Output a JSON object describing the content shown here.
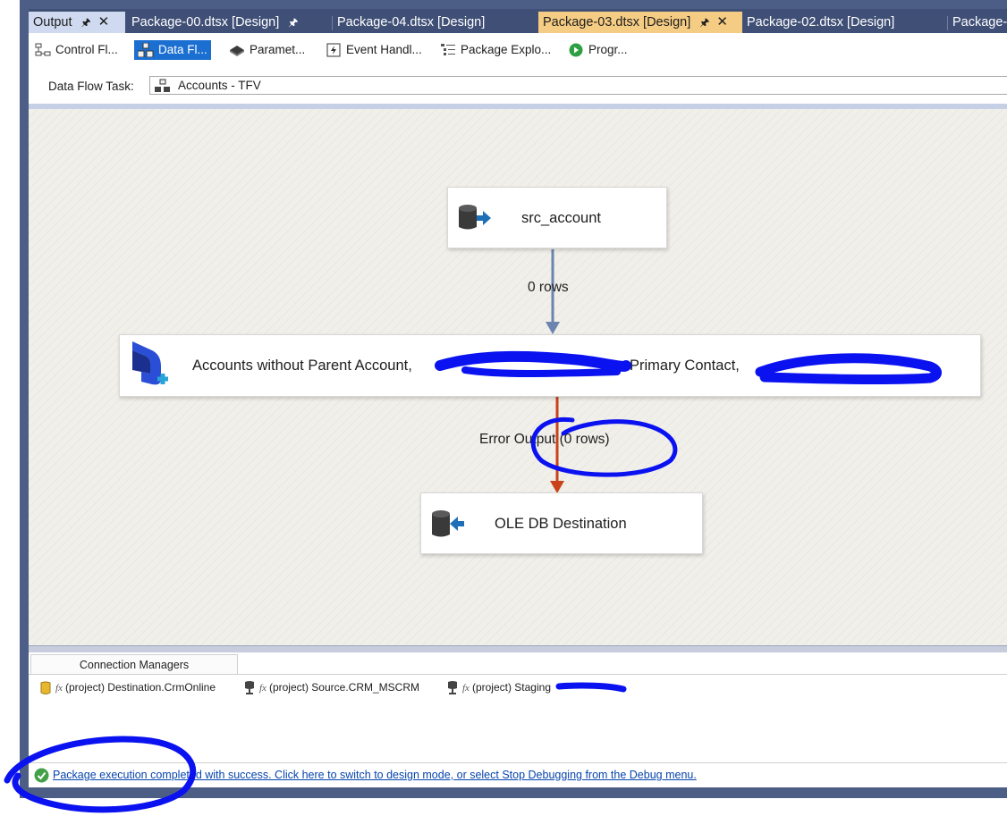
{
  "tabs": [
    {
      "label": "Output",
      "state": "pinned-output"
    },
    {
      "label": "Package-00.dtsx [Design]",
      "state": "inactive"
    },
    {
      "label": "Package-04.dtsx [Design]",
      "state": "inactive"
    },
    {
      "label": "Package-03.dtsx [Design]",
      "state": "active"
    },
    {
      "label": "Package-02.dtsx [Design]",
      "state": "inactive"
    },
    {
      "label": "Package-",
      "state": "inactive"
    }
  ],
  "toolbar": {
    "items": [
      {
        "label": "Control Fl...",
        "icon": "control-flow-icon"
      },
      {
        "label": "Data Fl...",
        "icon": "data-flow-icon",
        "selected": true
      },
      {
        "label": "Paramet...",
        "icon": "parameters-icon"
      },
      {
        "label": "Event Handl...",
        "icon": "event-handlers-icon"
      },
      {
        "label": "Package Explo...",
        "icon": "package-explorer-icon"
      },
      {
        "label": "Progr...",
        "icon": "progress-icon"
      }
    ]
  },
  "task": {
    "label": "Data Flow Task:",
    "value": "Accounts - TFV",
    "icon": "data-flow-task-icon"
  },
  "canvas": {
    "nodes": [
      {
        "label": "src_account",
        "icon": "source-database-icon"
      },
      {
        "label": "Accounts without Parent Account, ",
        "label_tail": "Primary Contact, ",
        "icon": "dynamics-crm-destination-icon"
      },
      {
        "label": "OLE DB Destination",
        "icon": "destination-database-icon"
      }
    ],
    "connectors": [
      {
        "label": "0 rows",
        "color": "#6b85b0"
      },
      {
        "label": "Error Output (0 rows)",
        "color": "#c8431b"
      }
    ]
  },
  "connection_managers": {
    "tab_label": "Connection Managers",
    "items": [
      {
        "label": "(project) Destination.CrmOnline",
        "icon": "crm-connection-icon"
      },
      {
        "label": "(project) Source.CRM_MSCRM",
        "icon": "oledb-connection-icon"
      },
      {
        "label": "(project) Staging",
        "icon": "oledb-connection-icon"
      }
    ]
  },
  "status": {
    "message": "Package execution completed with success. Click here to switch to design mode, or select Stop Debugging from the Debug menu.",
    "icon": "success-check-icon"
  },
  "colors": {
    "frame": "#4d5e86",
    "active_tab": "#f5cc84",
    "selected_toolbar": "#1b6fd1",
    "annotation_ink": "#0a12f0",
    "redaction": "#0a12f0"
  }
}
